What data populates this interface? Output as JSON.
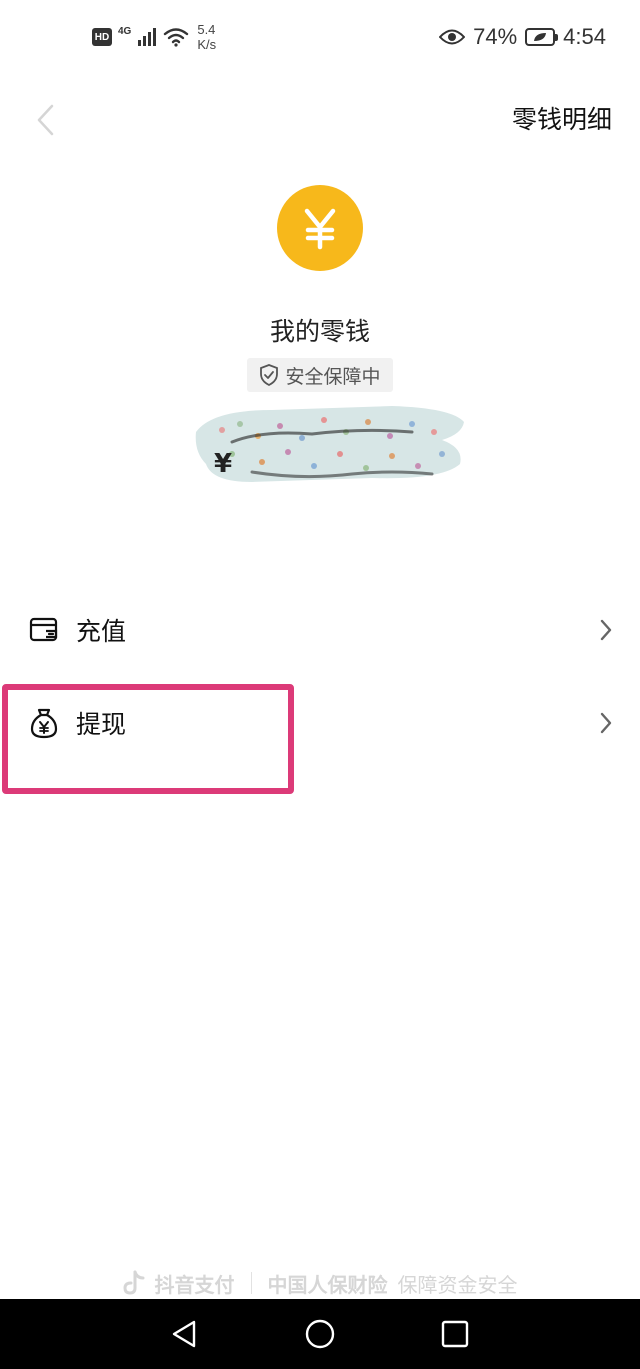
{
  "status_bar": {
    "hd": "HD",
    "network": "4G",
    "speed_value": "5.4",
    "speed_unit": "K/s",
    "battery": "74%",
    "time": "4:54"
  },
  "header": {
    "back_icon": "chevron-left-icon",
    "link": "零钱明细"
  },
  "balance": {
    "icon": "yuan-coin-icon",
    "icon_color": "#f7b81b",
    "title": "我的零钱",
    "security": "安全保障中",
    "currency_symbol": "¥"
  },
  "menu": [
    {
      "icon": "wallet-card-icon",
      "label": "充值"
    },
    {
      "icon": "money-bag-icon",
      "label": "提现"
    }
  ],
  "highlight_color": "#dc3a78",
  "footer": {
    "brand": "抖音支付",
    "insurer": "中国人保财险",
    "guarantee": "保障资金安全"
  }
}
